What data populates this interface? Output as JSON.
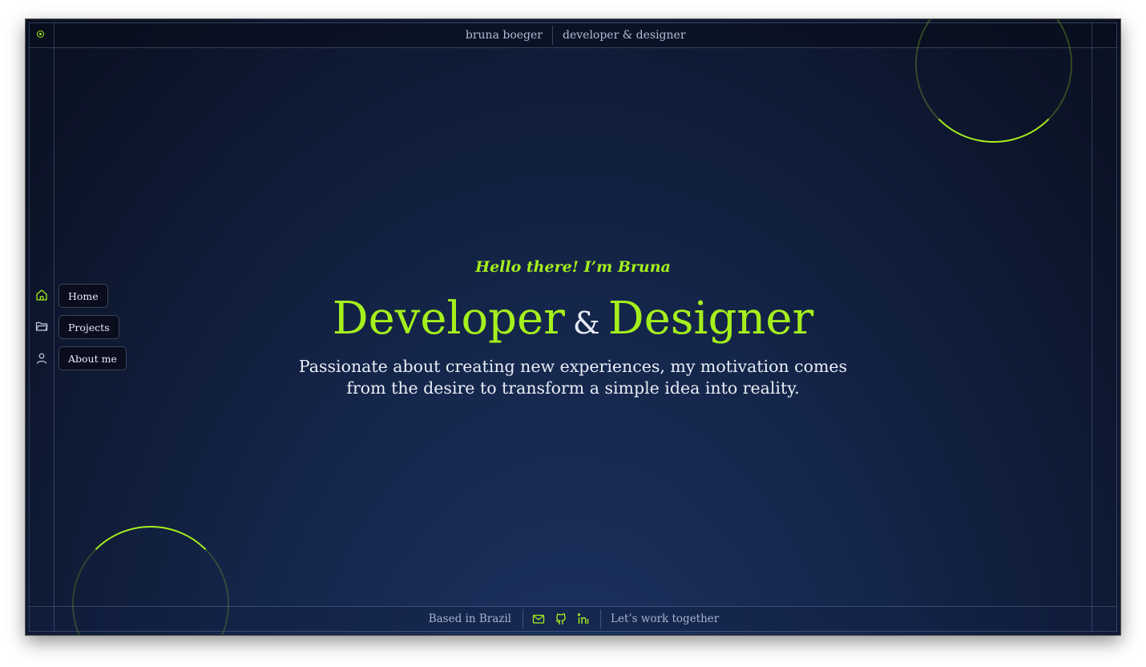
{
  "header": {
    "name": "bruna boeger",
    "role": "developer & designer",
    "status_icon": "status-dot-icon"
  },
  "nav": {
    "items": [
      {
        "label": "Home",
        "icon": "home-icon",
        "active": true
      },
      {
        "label": "Projects",
        "icon": "folder-icon",
        "active": false
      },
      {
        "label": "About me",
        "icon": "user-icon",
        "active": false
      }
    ]
  },
  "hero": {
    "greeting": "Hello there! I’m Bruna",
    "title_part1": "Developer",
    "title_amp": "&",
    "title_part2": "Designer",
    "tagline": "Passionate about creating new experiences, my motivation comes from the desire to transform a simple idea into reality."
  },
  "footer": {
    "location": "Based in Brazil",
    "cta": "Let’s work together",
    "social": [
      {
        "name": "email",
        "icon": "mail-icon"
      },
      {
        "name": "github",
        "icon": "github-icon"
      },
      {
        "name": "linkedin",
        "icon": "linkedin-icon"
      }
    ]
  },
  "colors": {
    "accent": "#a5ef1c",
    "background": "#0f1a35",
    "text": "#e7ebf4",
    "muted": "#a7b3cc"
  }
}
